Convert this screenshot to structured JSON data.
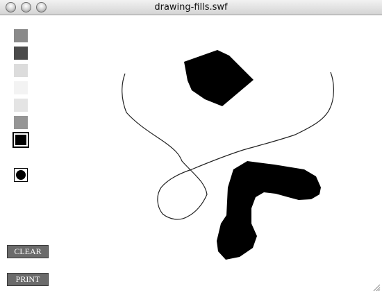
{
  "window": {
    "title": "drawing-fills.swf"
  },
  "palette": {
    "swatches": [
      {
        "color": "#8a8a8a",
        "selected": false
      },
      {
        "color": "#4a4a4a",
        "selected": false
      },
      {
        "color": "#dcdcdc",
        "selected": false
      },
      {
        "color": "#f3f3f3",
        "selected": false
      },
      {
        "color": "#e4e4e4",
        "selected": false
      },
      {
        "color": "#959595",
        "selected": false
      },
      {
        "color": "#000000",
        "selected": true
      }
    ]
  },
  "tools": {
    "brush_icon": "brush-dot-icon"
  },
  "buttons": {
    "clear_label": "CLEAR",
    "print_label": "PRINT"
  }
}
